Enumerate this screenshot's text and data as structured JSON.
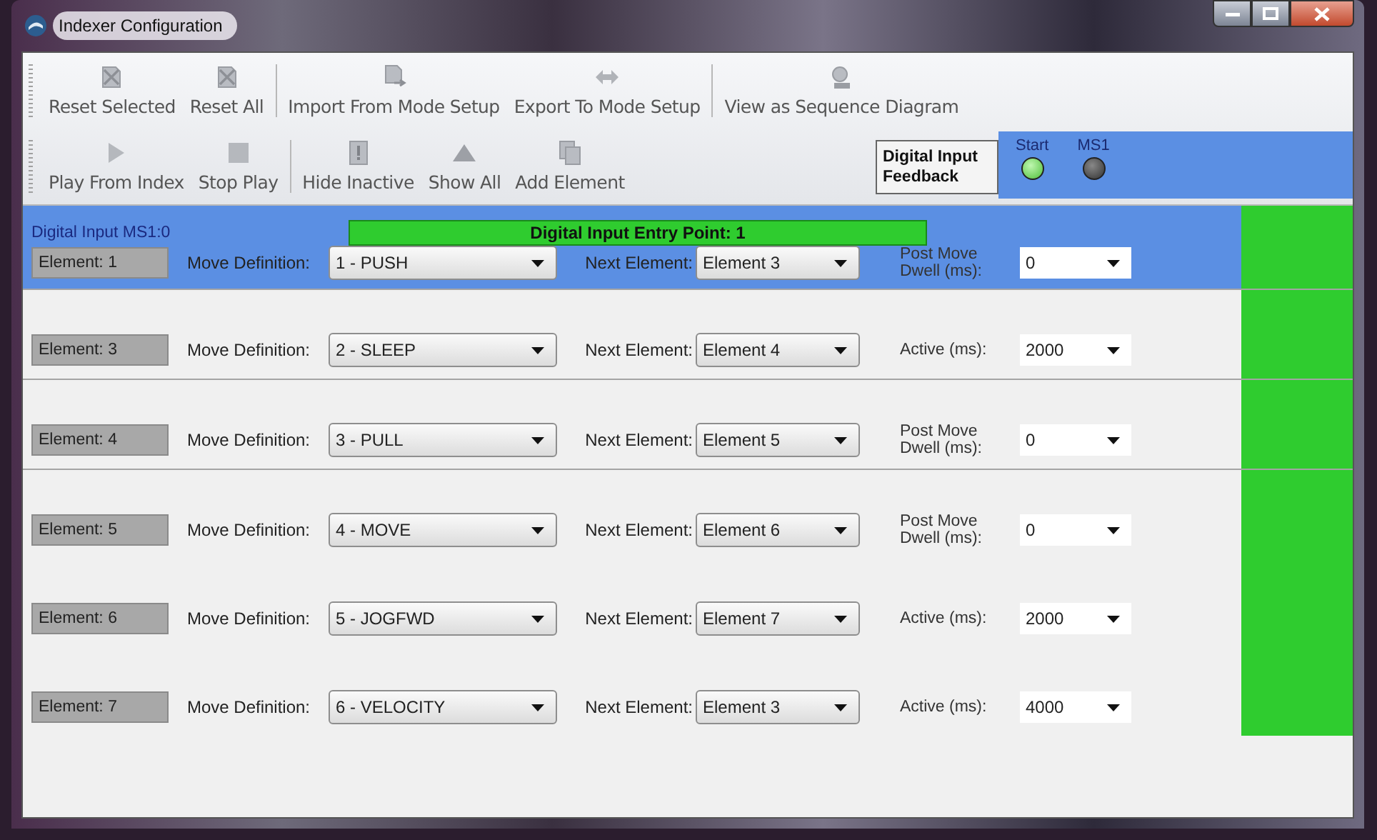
{
  "window": {
    "title": "Indexer Configuration"
  },
  "toolbar": {
    "rows": [
      [
        [
          {
            "label": "Reset Selected"
          },
          {
            "label": "Reset All"
          }
        ],
        [
          {
            "label": "Import From Mode Setup"
          },
          {
            "label": "Export To Mode Setup"
          }
        ],
        [
          {
            "label": "View as Sequence Diagram"
          }
        ]
      ],
      [
        [
          {
            "label": "Play From Index"
          },
          {
            "label": "Stop Play"
          }
        ],
        [
          {
            "label": "Hide Inactive"
          },
          {
            "label": "Show All"
          },
          {
            "label": "Add Element"
          }
        ]
      ]
    ]
  },
  "feedback": {
    "label": "Digital Input Feedback",
    "indicators": [
      {
        "label": "Start",
        "on": true
      },
      {
        "label": "MS1",
        "on": false
      }
    ]
  },
  "elements": [
    {
      "header": "Digital Input MS1:0",
      "entry_point": "Digital Input Entry Point: 1",
      "element": "Element: 1",
      "move_label": "Move Definition:",
      "move_definition": "1 - PUSH",
      "next_label": "Next Element:",
      "next_element": "Element 3",
      "param_label": "Post Move Dwell (ms):",
      "param_value": "0",
      "selected": true,
      "active": true
    },
    {
      "element": "Element: 3",
      "move_label": "Move Definition:",
      "move_definition": "2 - SLEEP",
      "next_label": "Next Element:",
      "next_element": "Element 4",
      "param_label": "Active (ms):",
      "param_value": "2000",
      "selected": false,
      "active": true
    },
    {
      "element": "Element: 4",
      "move_label": "Move Definition:",
      "move_definition": "3 - PULL",
      "next_label": "Next Element:",
      "next_element": "Element 5",
      "param_label": "Post Move Dwell (ms):",
      "param_value": "0",
      "selected": false,
      "active": true
    },
    {
      "element": "Element: 5",
      "move_label": "Move Definition:",
      "move_definition": "4 - MOVE",
      "next_label": "Next Element:",
      "next_element": "Element 6",
      "param_label": "Post Move Dwell (ms):",
      "param_value": "0",
      "selected": false,
      "active": true
    },
    {
      "element": "Element: 6",
      "move_label": "Move Definition:",
      "move_definition": "5 - JOGFWD",
      "next_label": "Next Element:",
      "next_element": "Element 7",
      "param_label": "Active (ms):",
      "param_value": "2000",
      "selected": false,
      "active": true
    },
    {
      "element": "Element: 7",
      "move_label": "Move Definition:",
      "move_definition": "6 - VELOCITY",
      "next_label": "Next Element:",
      "next_element": "Element 3",
      "param_label": "Active (ms):",
      "param_value": "4000",
      "selected": false,
      "active": true
    }
  ]
}
